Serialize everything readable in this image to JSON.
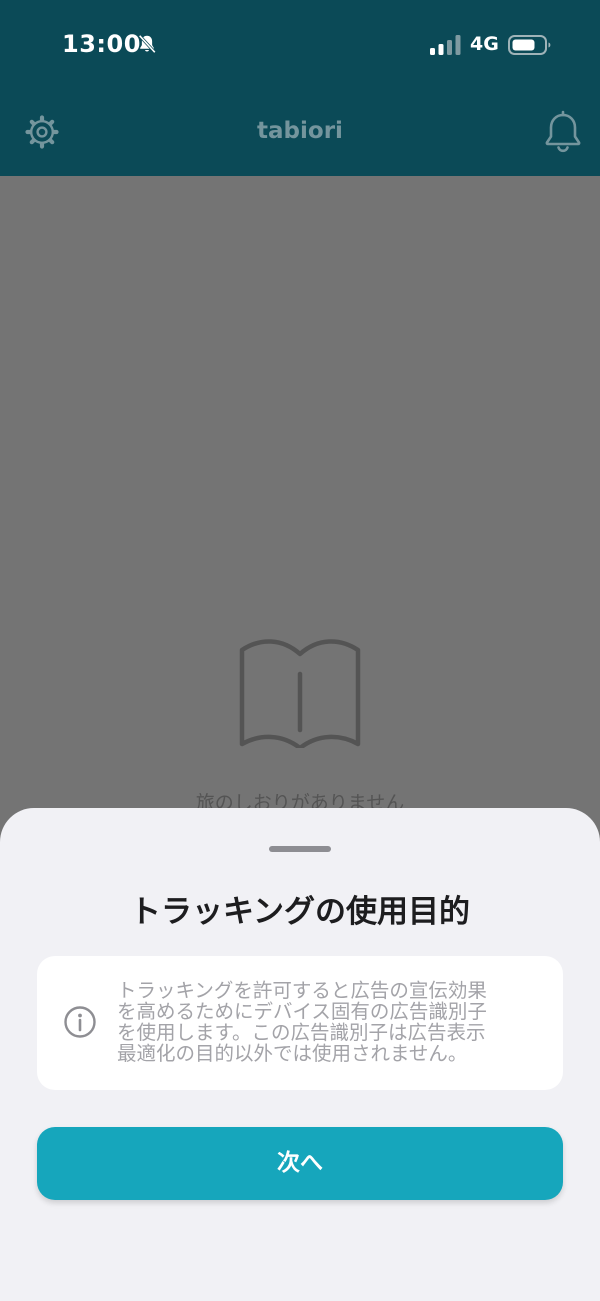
{
  "status_bar": {
    "time": "13:00",
    "network": "4G",
    "icons": [
      "bell-slash-icon",
      "cellular-signal-icon",
      "battery-icon"
    ]
  },
  "header": {
    "title": "tabiori",
    "left_icon": "gear-icon",
    "right_icon": "bell-icon"
  },
  "main": {
    "empty_icon": "open-book-icon",
    "empty_label": "旅のしおりがありません"
  },
  "tracking_sheet": {
    "title": "トラッキングの使用目的",
    "info_icon": "info-icon",
    "info_lines": [
      "トラッキングを許可すると広告の宣伝効果",
      "を高めるためにデバイス固有の広告識別子",
      "を使用します。この広告識別子は広告表示",
      "最適化の目的以外では使用されません。"
    ],
    "next_button_label": "次へ"
  },
  "colors": {
    "header_bg": "#0b4a57",
    "overlay_bg": "#747474",
    "sheet_bg": "#f1f1f5",
    "accent": "#16a6bc"
  }
}
